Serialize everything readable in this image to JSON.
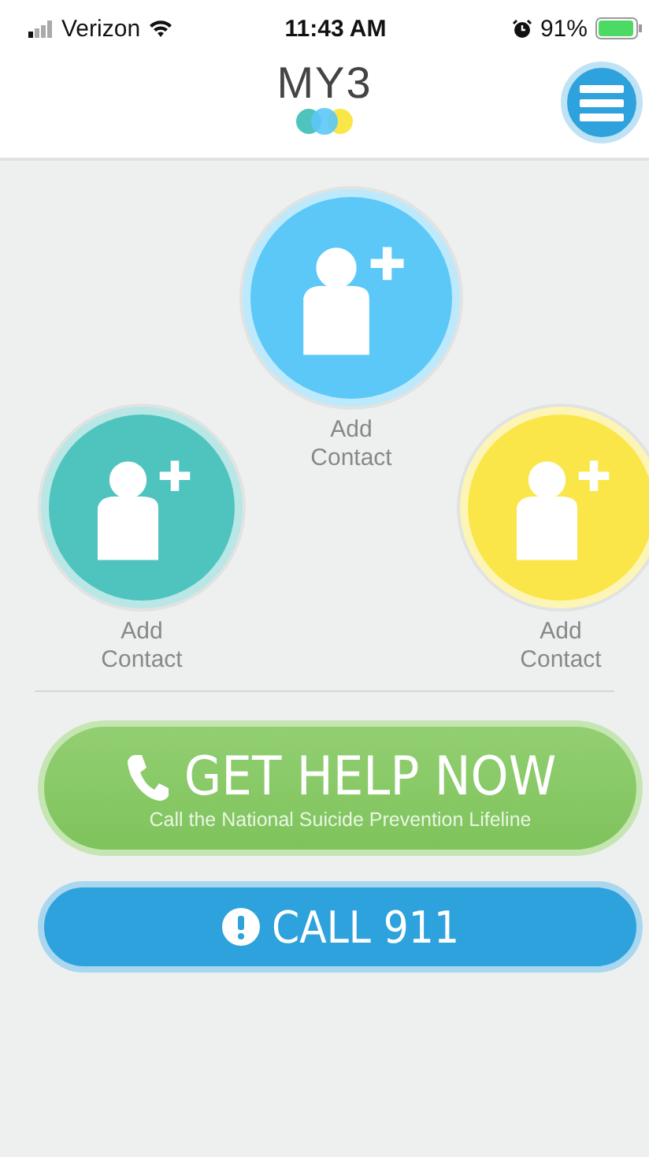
{
  "status_bar": {
    "carrier": "Verizon",
    "time": "11:43 AM",
    "battery": "91%"
  },
  "header": {
    "logo": "MY3"
  },
  "contacts": [
    {
      "label": "Add Contact",
      "color": "#5bc8f7"
    },
    {
      "label": "Add Contact",
      "color": "#4fc4bf"
    },
    {
      "label": "Add Contact",
      "color": "#fbe64a"
    }
  ],
  "help_button": {
    "title": "GET HELP NOW",
    "subtitle": "Call the National Suicide Prevention Lifeline"
  },
  "call_button": {
    "label": "CALL 911"
  }
}
